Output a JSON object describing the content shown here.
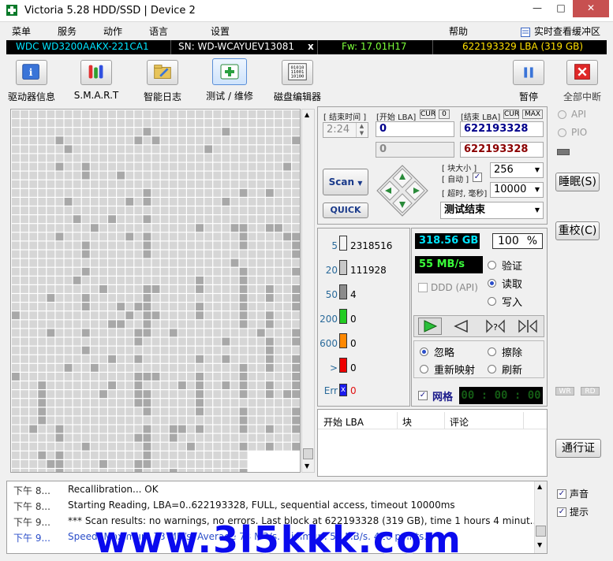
{
  "window": {
    "title": "Victoria 5.28 HDD/SSD | Device 2",
    "min": "—",
    "max": "□",
    "close": "✕"
  },
  "menu": {
    "items": [
      "菜单",
      "服务",
      "动作",
      "语言",
      "设置",
      "帮助"
    ],
    "cache_view": "实时查看缓冲区"
  },
  "device": {
    "model": "WDC WD3200AAKX-221CA1",
    "serial": "SN: WD-WCAYUEV13081",
    "x": "x",
    "firmware": "Fw: 17.01H17",
    "lba": "622193329 LBA (319 GB)"
  },
  "toolbar": {
    "driver_info": "驱动器信息",
    "smart": "S.M.A.R.T",
    "smart_log": "智能日志",
    "test_repair": "测试 / 维修",
    "disk_editor": "磁盘编辑器",
    "pause": "暂停",
    "abort_all": "全部中断"
  },
  "scan_panel": {
    "end_time_label": "[ 结束时间 ]",
    "start_lba_label": "[开始 LBA]",
    "cur_label": "CUR",
    "zero_label": "0",
    "end_lba_label": "[结束 LBA]",
    "max_label": "MAX",
    "end_time": "2:24",
    "start_lba": "0",
    "end_lba": "622193328",
    "start_lba_current": "0",
    "end_lba_current": "622193328",
    "block_size_label": "[ 块大小 ]",
    "auto_label": "[ 自动 ]",
    "timeout_label": "[ 超时, 毫秒]",
    "block_size": "256",
    "timeout": "10000",
    "scan_button": "Scan",
    "quick_button": "QUICK",
    "end_mode": "测试结束"
  },
  "stats": {
    "rows": [
      {
        "label": "5",
        "count": "2318516",
        "color": "#f4f4f4"
      },
      {
        "label": "20",
        "count": "111928",
        "color": "#c8c8c8"
      },
      {
        "label": "50",
        "count": "4",
        "color": "#8c8c8c"
      },
      {
        "label": "200",
        "count": "0",
        "color": "#22cc22"
      },
      {
        "label": "600",
        "count": "0",
        "color": "#ff8800"
      },
      {
        "label": ">",
        "count": "0",
        "color": "#ee0000"
      },
      {
        "label": "Err",
        "count": "0",
        "color": "#1a1aee"
      }
    ],
    "size_done": "318.56 GB",
    "percent": "100",
    "percent_unit": "%",
    "speed": "55 MB/s",
    "ddd_label": "DDD (API)"
  },
  "mode": {
    "verify": "验证",
    "read": "读取",
    "write": "写入",
    "selected": "读取"
  },
  "actions": {
    "ignore": "忽略",
    "erase": "擦除",
    "remap": "重新映射",
    "refresh": "刷新",
    "grid": "网格",
    "timer": "00 : 00 : 00"
  },
  "table": {
    "headers": [
      "开始 LBA",
      "块",
      "评论"
    ]
  },
  "right": {
    "api": "API",
    "pio": "PIO",
    "sleep": "睡眠(S)",
    "recalibrate": "重校(C)",
    "wr": "WR",
    "rd": "RD",
    "passport": "通行证",
    "sound": "声音",
    "hints": "提示"
  },
  "log": {
    "rows": [
      {
        "time": "下午 8...",
        "text": "Recallibration... OK"
      },
      {
        "time": "下午 8...",
        "text": "Starting Reading, LBA=0..622193328, FULL, sequential access, timeout 10000ms"
      },
      {
        "time": "下午 9...",
        "text": "*** Scan results: no warnings, no errors. Last block at 622193328 (319 GB), time 1 hours 4 minut..."
      },
      {
        "time": "下午 9...",
        "text": "Speed: Maximum 73 MB/s. Average 73 MB/s. Minimum 55 MB/s. 420 points."
      }
    ]
  },
  "watermark": "www.3l5kkk.com"
}
